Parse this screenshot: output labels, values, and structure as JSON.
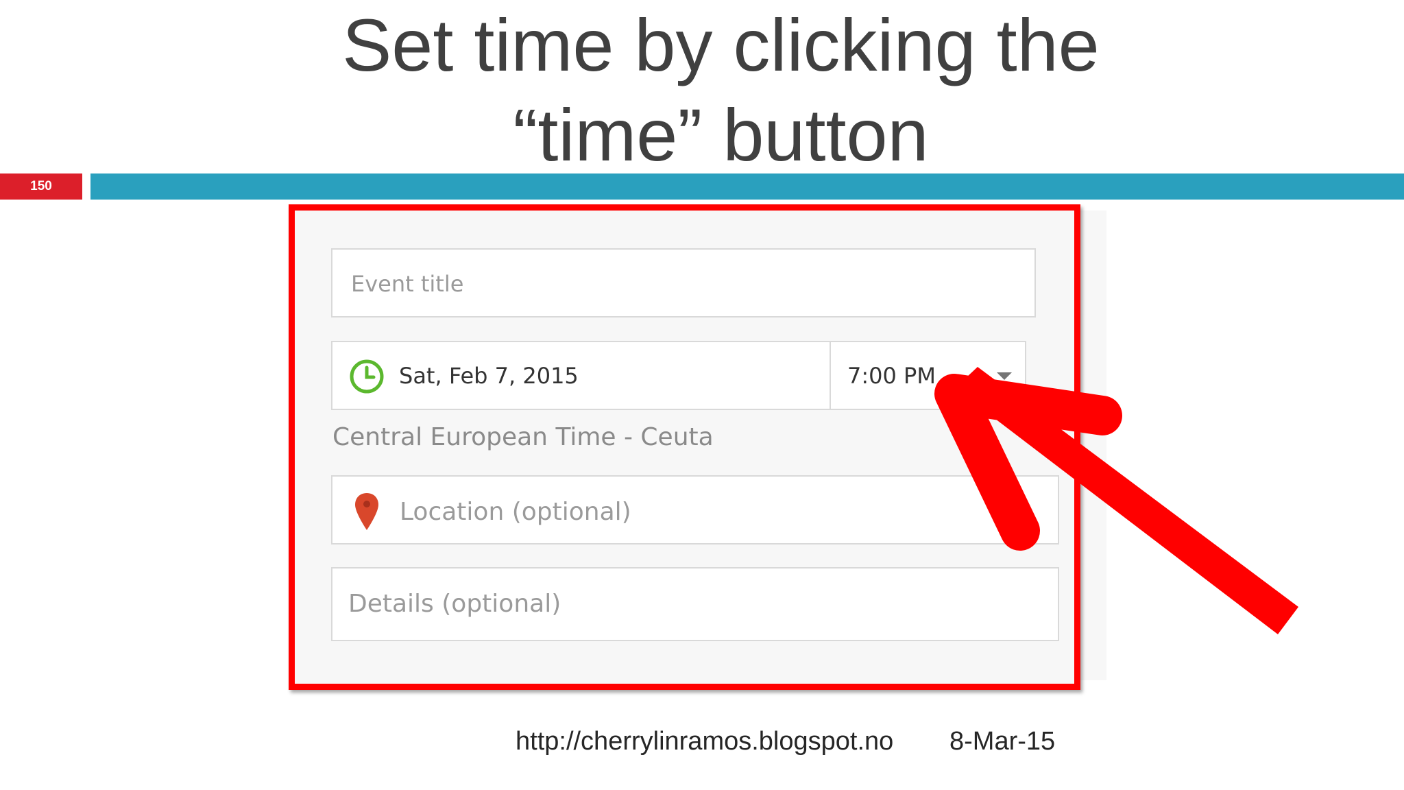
{
  "slide": {
    "title_line1": "Set time by clicking the",
    "title_line2": "“time” button",
    "slide_number": "150",
    "accent_color": "#dc1f2a",
    "rule_color": "#2aa0be"
  },
  "form": {
    "event_title_placeholder": "Event title",
    "date_value": "Sat, Feb 7, 2015",
    "time_value": "7:00 PM",
    "timezone": "Central European Time - Ceuta",
    "location_placeholder": "Location (optional)",
    "details_placeholder": "Details (optional)",
    "icons": {
      "date": "clock-icon",
      "time_dropdown": "caret-down-icon",
      "location": "map-pin-icon"
    },
    "clock_color": "#5bb82e",
    "pin_color": "#d9472b"
  },
  "annotation": {
    "highlight_color": "#ff0000",
    "arrow_target": "time-button"
  },
  "footer": {
    "source": "http://cherrylinramos.blogspot.no",
    "date": "8-Mar-15"
  }
}
